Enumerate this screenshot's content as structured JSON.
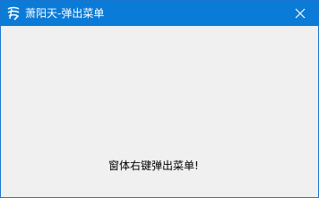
{
  "window": {
    "title": "萧阳天-弹出菜单",
    "title_bar_color": "#0a7bd7",
    "icon": "app-logo-icon",
    "close_icon": "close-icon"
  },
  "client": {
    "background": "#f0f0f0",
    "hint_text": "窗体右键弹出菜单!"
  }
}
